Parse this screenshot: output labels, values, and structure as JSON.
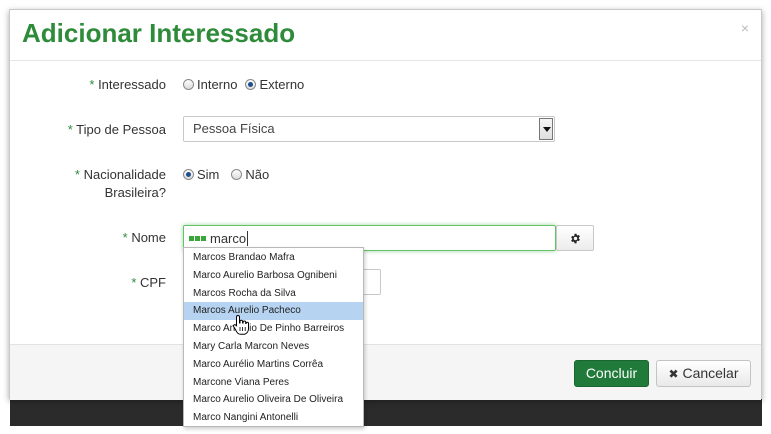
{
  "modal": {
    "title": "Adicionar Interessado",
    "close": "×"
  },
  "form": {
    "required_mark": "*",
    "interessado": {
      "label": "Interessado",
      "options": [
        {
          "label": "Interno",
          "checked": false
        },
        {
          "label": "Externo",
          "checked": true
        }
      ]
    },
    "tipo_pessoa": {
      "label": "Tipo de Pessoa",
      "selected": "Pessoa Física"
    },
    "nacionalidade": {
      "label_line1": "Nacionalidade",
      "label_line2": "Brasileira?",
      "options": [
        {
          "label": "Sim",
          "checked": true
        },
        {
          "label": "Não",
          "checked": false
        }
      ]
    },
    "nome": {
      "label": "Nome",
      "value": "marco"
    },
    "cpf": {
      "label": "CPF"
    }
  },
  "autocomplete": {
    "hovered_index": 3,
    "items": [
      "Marcos Brandao Mafra",
      "Marco Aurelio Barbosa Ognibeni",
      "Marcos Rocha da Silva",
      "Marcos Aurelio Pacheco",
      "Marco Antonio De Pinho Barreiros",
      "Mary Carla Marcon Neves",
      "Marco Aurélio Martins Corrêa",
      "Marcone Viana Peres",
      "Marco Aurelio Oliveira De Oliveira",
      "Marco Nangini Antonelli"
    ]
  },
  "footer": {
    "concluir_label": "Concluir",
    "cancelar_label": "Cancelar",
    "cancelar_icon": "✖"
  },
  "colors": {
    "title_green": "#2e8b3a",
    "primary_button": "#207a3a",
    "dropdown_highlight": "#b6d4f1"
  },
  "icons": {
    "gear": "gear-icon",
    "close": "close-icon",
    "cancel": "times-icon",
    "cursor": "hand-pointer-icon"
  }
}
